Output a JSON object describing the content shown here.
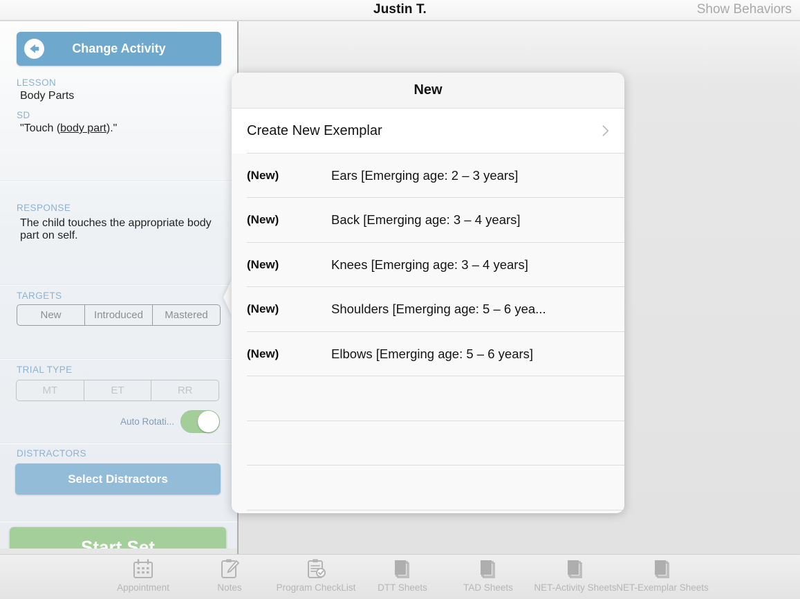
{
  "topbar": {
    "title": "Justin T.",
    "action_label": "Show Behaviors"
  },
  "sidebar": {
    "change_activity_label": "Change Activity",
    "lesson_label": "LESSON",
    "lesson_value": "Body Parts",
    "sd_label": "SD",
    "sd_value": "\"Touch (body part).\"",
    "sd_value_prefix": "\"Touch (",
    "sd_value_underlined": "body part",
    "sd_value_suffix": ").\"",
    "response_label": "RESPONSE",
    "response_value": "The child touches the appropriate body part on self.",
    "targets_label": "TARGETS",
    "targets_options": [
      "New",
      "Introduced",
      "Mastered"
    ],
    "trial_type_label": "TRIAL TYPE",
    "trial_type_options": [
      "MT",
      "ET",
      "RR"
    ],
    "auto_rotation_label": "Auto Rotati...",
    "auto_rotation_on": true,
    "distractors_label": "DISTRACTORS",
    "select_distractors_label": "Select Distractors",
    "start_set_label": "Start Set"
  },
  "popover": {
    "title": "New",
    "create_row": {
      "label": "Create New Exemplar",
      "icon": "chevron-right-icon"
    },
    "rows": [
      {
        "tag": "(New)",
        "label": "Ears [Emerging age:  2 – 3 years]"
      },
      {
        "tag": "(New)",
        "label": "Back [Emerging age:  3 – 4 years]"
      },
      {
        "tag": "(New)",
        "label": "Knees [Emerging age:  3 – 4 years]"
      },
      {
        "tag": "(New)",
        "label": "Shoulders [Emerging age:  5 – 6 yea..."
      },
      {
        "tag": "(New)",
        "label": "Elbows [Emerging age:  5 – 6 years]"
      },
      {
        "tag": "",
        "label": ""
      },
      {
        "tag": "",
        "label": ""
      },
      {
        "tag": "",
        "label": ""
      }
    ]
  },
  "tabbar": {
    "tabs": [
      {
        "label": "Appointment",
        "icon": "calendar-icon"
      },
      {
        "label": "Notes",
        "icon": "notes-pencil-icon"
      },
      {
        "label": "Program CheckList",
        "icon": "clipboard-check-icon"
      },
      {
        "label": "DTT Sheets",
        "icon": "sheets-stack-icon"
      },
      {
        "label": "TAD Sheets",
        "icon": "sheets-stack-icon"
      },
      {
        "label": "NET-Activity Sheets",
        "icon": "sheets-stack-icon"
      },
      {
        "label": "NET-Exemplar Sheets",
        "icon": "sheets-stack-icon"
      }
    ]
  },
  "colors": {
    "accent_blue": "#6fa8cd",
    "button_blue": "#93bcd9",
    "accent_green": "#a4cf9b",
    "toggle_green": "#a3ce9a",
    "label_blue": "#8cb2d4"
  }
}
